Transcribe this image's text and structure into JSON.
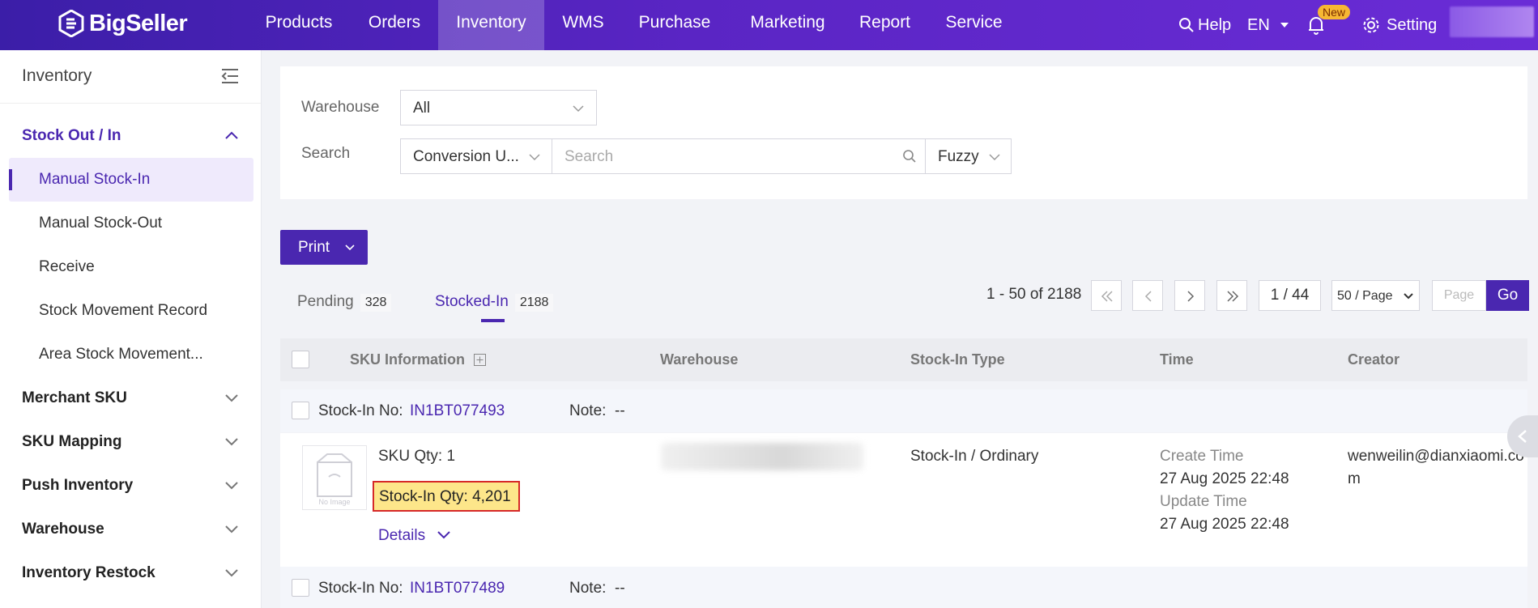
{
  "brand": {
    "name": "BigSeller"
  },
  "topnav": {
    "items": [
      "Products",
      "Orders",
      "Inventory",
      "WMS",
      "Purchase",
      "Marketing",
      "Report",
      "Service"
    ],
    "active": "Inventory",
    "help": "Help",
    "lang": "EN",
    "new_badge": "New",
    "setting": "Setting"
  },
  "sidebar": {
    "title": "Inventory",
    "group_stock": "Stock Out / In",
    "subitems": [
      "Manual Stock-In",
      "Manual Stock-Out",
      "Receive",
      "Stock Movement Record",
      "Area Stock Movement..."
    ],
    "groups": [
      "Merchant SKU",
      "SKU Mapping",
      "Push Inventory",
      "Warehouse",
      "Inventory Restock"
    ]
  },
  "filters": {
    "warehouse_label": "Warehouse",
    "warehouse_value": "All",
    "search_label": "Search",
    "search_type": "Conversion U...",
    "search_placeholder": "Search",
    "match_mode": "Fuzzy"
  },
  "toolbar": {
    "print_label": "Print"
  },
  "tabs": [
    {
      "label": "Pending",
      "count": "328"
    },
    {
      "label": "Stocked-In",
      "count": "2188"
    }
  ],
  "pagination": {
    "range": "1 - 50 of 2188",
    "page": "1 / 44",
    "page_size": "50 / Page",
    "page_input_placeholder": "Page",
    "go": "Go"
  },
  "table": {
    "headers": [
      "SKU Information",
      "Warehouse",
      "Stock-In Type",
      "Time",
      "Creator"
    ],
    "stockin_no_label": "Stock-In No:",
    "note_label": "Note:",
    "rows": [
      {
        "stockin_no": "IN1BT077493",
        "note": "--",
        "sku_qty": "SKU Qty: 1",
        "stockin_qty": "Stock-In Qty: 4,201",
        "details": "Details",
        "type": "Stock-In / Ordinary",
        "create_label": "Create Time",
        "create_time": "27 Aug 2025 22:48",
        "update_label": "Update Time",
        "update_time": "27 Aug 2025 22:48",
        "creator_line1": "wenweilin@dianxiaomi.co",
        "creator_line2": "m",
        "no_image": "No Image"
      },
      {
        "stockin_no": "IN1BT077489",
        "note": "--"
      }
    ]
  },
  "colors": {
    "brand": "#4a27b0",
    "highlight": "#fde68a",
    "highlight_border": "#d62828"
  }
}
